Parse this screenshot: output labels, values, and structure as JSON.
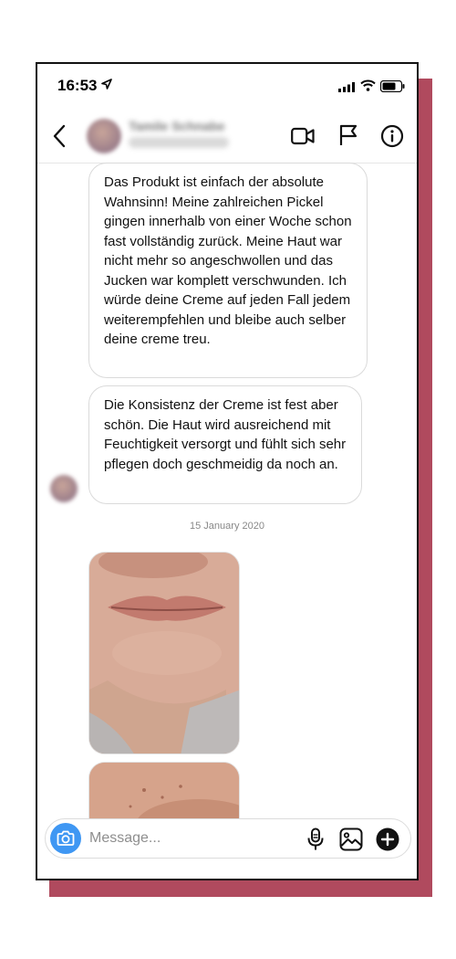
{
  "status_bar": {
    "time": "16:53"
  },
  "header": {
    "contact_name": "Tamile Schnabe",
    "contact_sub": "active recently"
  },
  "messages": [
    {
      "text": "Das Produkt ist einfach der absolute Wahnsinn! Meine zahlreichen Pickel gingen innerhalb von einer Woche schon fast vollständig zurück. Meine Haut war nicht mehr so angeschwollen und das Jucken war komplett verschwunden. Ich würde deine Creme auf jeden Fall jedem weiterempfehlen und bleibe auch selber deine creme treu."
    },
    {
      "text": "Die Konsistenz der Creme ist fest aber schön. Die Haut wird ausreichend mit Feuchtigkeit versorgt und fühlt sich sehr pflegen doch geschmeidig da noch an."
    }
  ],
  "date_separator": "15 January 2020",
  "composer": {
    "placeholder": "Message..."
  },
  "icons": {
    "back": "chevron-left-icon",
    "video": "video-camera-icon",
    "flag": "flag-icon",
    "info": "info-icon",
    "camera": "camera-icon",
    "mic": "microphone-icon",
    "gallery": "image-icon",
    "plus": "plus-circle-icon"
  },
  "colors": {
    "accent_shadow": "#b04a5e",
    "camera_button": "#3f97f3"
  }
}
